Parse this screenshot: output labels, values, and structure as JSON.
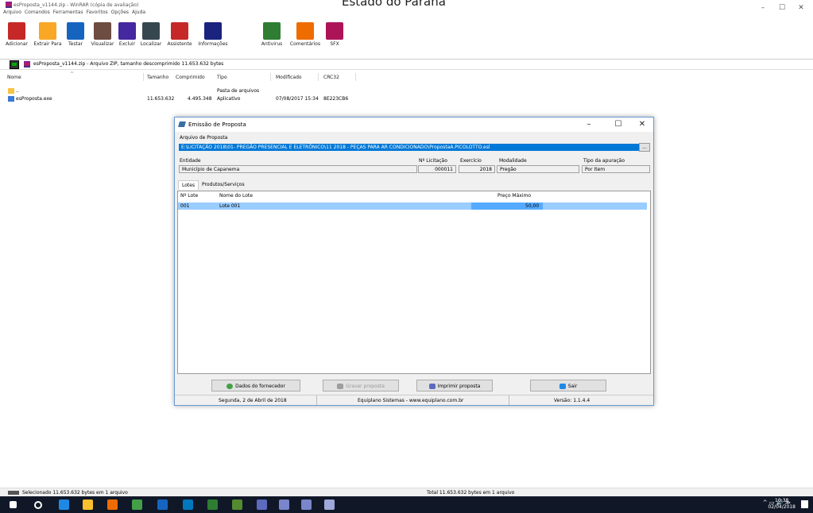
{
  "window": {
    "title": "esProposta_v1144.zip - WinRAR (cópia de avaliação)",
    "background_heading": "Estado do Paraná",
    "controls": {
      "minimize": "–",
      "maximize": "☐",
      "close": "✕"
    }
  },
  "menu": [
    "Arquivo",
    "Comandos",
    "Ferramentas",
    "Favoritos",
    "Opções",
    "Ajuda"
  ],
  "toolbar": [
    {
      "label": "Adicionar",
      "icon": "add-archive-icon",
      "color": "#c62828"
    },
    {
      "label": "Extrair Para",
      "icon": "extract-icon",
      "color": "#f9a825"
    },
    {
      "label": "Testar",
      "icon": "test-icon",
      "color": "#1565c0"
    },
    {
      "label": "Visualizar",
      "icon": "view-icon",
      "color": "#6d4c41"
    },
    {
      "label": "Excluir",
      "icon": "delete-icon",
      "color": "#4527a0"
    },
    {
      "label": "Localizar",
      "icon": "find-icon",
      "color": "#37474f"
    },
    {
      "label": "Assistente",
      "icon": "wizard-icon",
      "color": "#c62828"
    },
    {
      "label": "Informações",
      "icon": "info-icon",
      "color": "#1a237e"
    },
    {
      "label": "Antivirus",
      "icon": "antivirus-icon",
      "color": "#2e7d32"
    },
    {
      "label": "Comentários",
      "icon": "comment-icon",
      "color": "#ef6c00"
    },
    {
      "label": "SFX",
      "icon": "sfx-icon",
      "color": "#ad1457"
    }
  ],
  "address": {
    "text": "esProposta_v1144.zip - Arquivo ZIP, tamanho descomprimido 11.653.632 bytes"
  },
  "file_list": {
    "columns": [
      "Nome",
      "Tamanho",
      "Comprimido",
      "Tipo",
      "Modificado",
      "CRC32"
    ],
    "rows": [
      {
        "name": "..",
        "size": "",
        "packed": "",
        "type": "Pasta de arquivos",
        "modified": "",
        "crc": "",
        "icon": "folder-icon"
      },
      {
        "name": "esProposta.exe",
        "size": "11.653.632",
        "packed": "4.495.348",
        "type": "Aplicativo",
        "modified": "07/08/2017 15:34",
        "crc": "8E223CB6",
        "icon": "exe-icon"
      }
    ]
  },
  "dialog": {
    "title": "Emissão de Proposta",
    "file_label": "Arquivo de Proposta",
    "file_path": "E:\\LICITAÇÃO 2018\\01- PREGÃO PRESENCIAL E ELETRÔNICO\\11 2018 - PEÇAS PARA AR CONDICIONADO\\PropostaA.PICOLOTTO.esl",
    "browse_label": "...",
    "entity_label": "Entidade",
    "entity_value": "Município de Capanema",
    "licitacao_label": "Nº Licitação",
    "licitacao_value": "000011",
    "exercicio_label": "Exercício",
    "exercicio_value": "2018",
    "modalidade_label": "Modalidade",
    "modalidade_value": "Pregão",
    "apuracao_label": "Tipo da apuração",
    "apuracao_value": "Por Item",
    "tabs": [
      "Lotes",
      "Produtos/Serviços"
    ],
    "grid": {
      "columns": [
        "Nº Lote",
        "Nome do Lote",
        "Preço Máximo"
      ],
      "rows": [
        {
          "lote": "001",
          "nome": "Lote 001",
          "preco": "50,00"
        }
      ]
    },
    "buttons": {
      "fornecedor": "Dados do fornecedor",
      "gravar": "Gravar proposta",
      "imprimir": "Imprimir proposta",
      "sair": "Sair"
    },
    "status": {
      "date": "Segunda, 2 de Abril de 2018",
      "company": "Equiplano Sistemas - www.equiplano.com.br",
      "version": "Versão: 1.1.4.4"
    }
  },
  "statusbar": {
    "left": "Selecionado 11.653.632 bytes em 1 arquivo",
    "right": "Total 11.653.632 bytes em 1 arquivo"
  },
  "taskbar": {
    "time": "10:38",
    "date": "02/04/2018",
    "apps": [
      {
        "icon": "start-icon",
        "color": "#ffffff"
      },
      {
        "icon": "search-icon",
        "color": "#ffffff"
      },
      {
        "icon": "edge-icon",
        "color": "#1e88e5"
      },
      {
        "icon": "file-explorer-icon",
        "color": "#fbc02d"
      },
      {
        "icon": "firefox-icon",
        "color": "#ef6c00"
      },
      {
        "icon": "chrome-icon",
        "color": "#43a047"
      },
      {
        "icon": "word-icon",
        "color": "#1565c0"
      },
      {
        "icon": "outlook-icon",
        "color": "#0277bd"
      },
      {
        "icon": "excel-icon",
        "color": "#2e7d32"
      },
      {
        "icon": "map-app-icon",
        "color": "#558b2f"
      },
      {
        "icon": "grid-app-icon",
        "color": "#5c6bc0"
      },
      {
        "icon": "proposta-app-icon",
        "color": "#7986cb"
      },
      {
        "icon": "proposta-app-icon-2",
        "color": "#7986cb"
      },
      {
        "icon": "proposta-app-icon-3",
        "color": "#9fa8da"
      }
    ]
  }
}
